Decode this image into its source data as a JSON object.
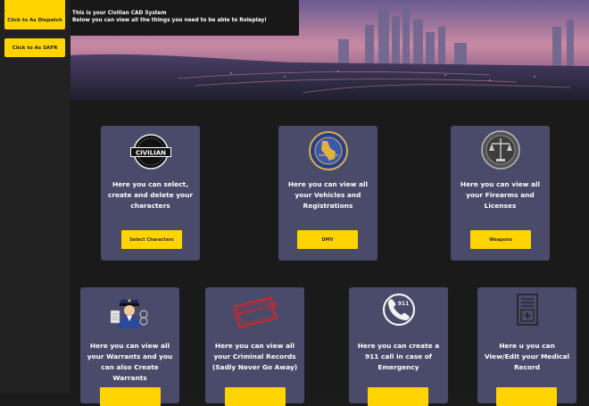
{
  "sidebar": {
    "buttons": [
      {
        "label": ""
      },
      {
        "label": "Click to As Dispatch"
      },
      {
        "label": "Click to As SAFR"
      }
    ]
  },
  "intro": {
    "line1": "This is your Civilian CAD System",
    "line2": "Below you can view all the things you need to be able to Roleplay!"
  },
  "cards": [
    {
      "text": "Here you can select, create and delete your characters",
      "button": "Select Characters",
      "icon": "civilian-badge-icon",
      "badge_text": "CIVILIAN"
    },
    {
      "text": "Here you can view all your Vehicles and Registrations",
      "button": "DMV",
      "icon": "dmv-seal-icon"
    },
    {
      "text": "Here you can view all your Firearms and Licenses",
      "button": "Weapons",
      "icon": "justice-seal-icon"
    },
    {
      "text": "Here you can view all your Warrants and you can also Create Warrants",
      "button": "",
      "icon": "police-officer-icon"
    },
    {
      "text": "Here you can view all your Criminal Records (Sadly Never Go Away)",
      "button": "",
      "icon": "criminal-record-stamp-icon",
      "stamp_text": "CRIMINAL RECORD"
    },
    {
      "text": "Here you can create a 911 call in case of Emergency",
      "button": "",
      "icon": "phone-911-icon",
      "badge_text": "911"
    },
    {
      "text": "Here u you can View/Edit your Medical Record",
      "button": "",
      "icon": "medical-record-icon"
    }
  ],
  "colors": {
    "accent": "#ffd400",
    "card": "#4a4a6a",
    "background": "#1a1a1a",
    "sidebar": "#222222"
  }
}
